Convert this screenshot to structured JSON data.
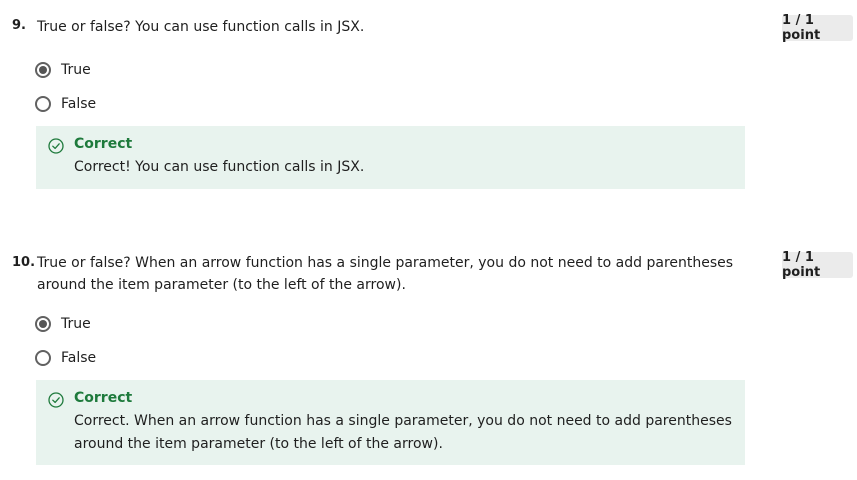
{
  "questions": [
    {
      "number": "9.",
      "text": "True or false? You can use function calls in JSX.",
      "score": "1 / 1 point",
      "options": [
        {
          "label": "True",
          "selected": true
        },
        {
          "label": "False",
          "selected": false
        }
      ],
      "feedback": {
        "title": "Correct",
        "text": "Correct! You can use function calls in JSX."
      }
    },
    {
      "number": "10.",
      "text": "True or false? When an arrow function has a single parameter, you do not need to add parentheses around the item parameter (to the left of the arrow).",
      "score": "1 / 1 point",
      "options": [
        {
          "label": "True",
          "selected": true
        },
        {
          "label": "False",
          "selected": false
        }
      ],
      "feedback": {
        "title": "Correct",
        "text": "Correct. When an arrow function has a single parameter, you do not need to add parentheses around the item parameter (to the left of the arrow)."
      }
    }
  ],
  "colors": {
    "feedback_bg": "#e8f3ee",
    "correct_green": "#1e7a3c",
    "score_bg": "#ebebeb"
  }
}
